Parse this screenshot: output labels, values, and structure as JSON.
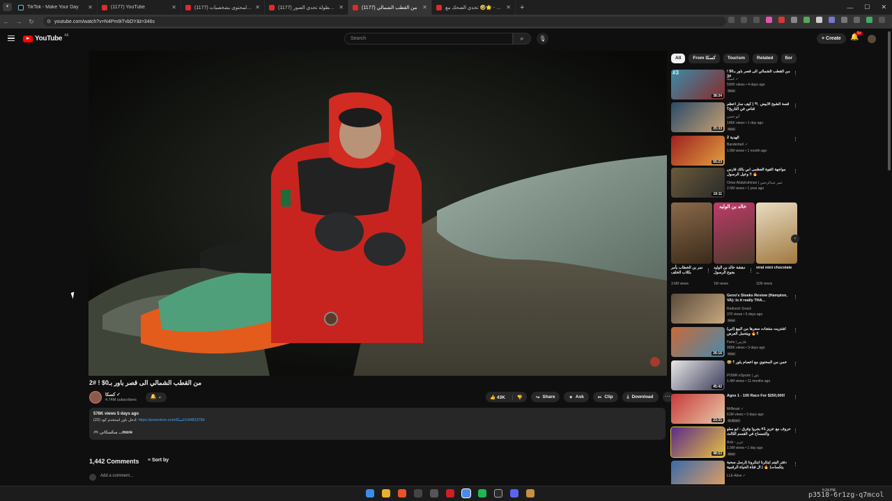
{
  "browser": {
    "tabs": [
      {
        "title": "TikTok - Make Your Day",
        "icon": "tiktok-icon"
      },
      {
        "title": "(1177) YouTube",
        "icon": "youtube-icon"
      },
      {
        "title": "(1177) صناع المحتوى بشخصيات",
        "icon": "youtube-icon"
      },
      {
        "title": "(1177) بطولة تحدي الصور 🌙",
        "icon": "youtube-icon"
      },
      {
        "title": "(1177) من القطب الشمالي",
        "icon": "youtube-icon",
        "active": true
      },
      {
        "title": "تحدي الضحك مع 🤣🌟 - YouTube",
        "icon": "youtube-icon"
      }
    ],
    "url": "youtube.com/watch?v=N4Pm9iTvbDY&t=346s"
  },
  "youtube": {
    "logo": "YouTube",
    "region": "AE",
    "search_placeholder": "Search",
    "create_label": "+ Create",
    "notif_count": "9+"
  },
  "video": {
    "title": "من القطب الشمالي الى قصر باور بـ0$ ! #2",
    "channel": "كسكا ✓",
    "subscribers": "4.74M subscribers",
    "likes": "43K",
    "share": "Share",
    "ask": "Ask",
    "clip": "Clip",
    "download": "Download",
    "desc_meta": "576K views  5 days ago",
    "desc_text": "ادخل باور استخدم كود (22): ",
    "desc_link": "https://powrstore.com/كسكا/c94823789",
    "desc_more": "...more",
    "desc_tag": "🎮 سكسكاني"
  },
  "comments": {
    "count": "1,442 Comments",
    "sort": "Sort by",
    "add": "Add a comment..."
  },
  "sidebar": {
    "chips": [
      "All",
      "From كسكا",
      "Tourism",
      "Related",
      "For"
    ],
    "recs_top": [
      {
        "title": "من القطب الشمالي الى قصر باور بـ0$ ! 3#",
        "channel": "كسكا ✓",
        "views": "500K views • 4 days ago",
        "badge": "New",
        "duration": "38:34",
        "rank": "#3"
      },
      {
        "title": "قصة الشبح الأبيض 🔍 | كيف سار أعظم قناص في التاريخ؟",
        "channel": "أبو حسن",
        "views": "146K views • 1 day ago",
        "badge": "New",
        "duration": "25:33"
      },
      {
        "title": "الهدية 2",
        "channel": "BanderitaX ✓",
        "views": "1.6M views • 1 month ago",
        "badge": "",
        "duration": "55:23"
      },
      {
        "title": "مواجهة القوة العظمى ابي بالك فارس وعيل الرسول ‼ 🔥",
        "channel": "Omar Abdulrahman | عمر عبدالرحمن",
        "views": "2.6M views • 1 year ago",
        "badge": "",
        "duration": "19:11"
      }
    ],
    "shorts": [
      {
        "title": "نمر بن الخطاب يأمر بكلاب الخلف",
        "views": "3.6M views",
        "caption": ""
      },
      {
        "title": "دهشة خالد بن الوليد بجوع الرسول",
        "views": "1M views",
        "caption": "خالد بن الوليد"
      },
      {
        "title": "viral mini chocolate ...",
        "views": "11M views",
        "caption": ""
      }
    ],
    "recs_bottom": [
      {
        "title": "Geno's Steaks Review (Hampton, VA): Is it really THA...",
        "channel": "Redneck Snack",
        "views": "370 views • 5 days ago",
        "badge": "New",
        "duration": ""
      },
      {
        "title": "اشتريت منتجات سعرها من البيع (ابي) ويتحمل العرض 🔥‼",
        "channel": "Faris | فارس",
        "views": "905K views • 3 days ago",
        "badge": "New",
        "duration": "26:16"
      },
      {
        "title": "😂 خمن من المحتوي مع اعصام ياور ؟",
        "channel": "POWR eSports | باور",
        "views": "1.4M views • 11 months ago",
        "badge": "",
        "duration": "45:42"
      },
      {
        "title": "Ages 1 - 100 Race For $250,000!",
        "channel": "MrBeast ✓",
        "views": "61M views • 3 days ago",
        "badge": "Dubbed",
        "duration": "23:31"
      },
      {
        "title": "حروف مع عزيز 1# بجروا وفرق - ابو سلو والتمساح في القسم الثالث",
        "channel": "Aziz - عزيز",
        "views": "1.5M views • 1 day ago",
        "badge": "New",
        "duration": "48:53"
      },
      {
        "title": "دفتر اليتم ايتكرنا ابتكرونا (ارسل سحبة يتكسات) 🔥 | ال قناة الحياة الرقمية",
        "channel": "LLE-Alive ✓",
        "views": "",
        "badge": "",
        "duration": ""
      }
    ]
  },
  "taskbar": {
    "time": "5:24 PM",
    "watermark": "p3518-6r1zg-q7mcol"
  }
}
